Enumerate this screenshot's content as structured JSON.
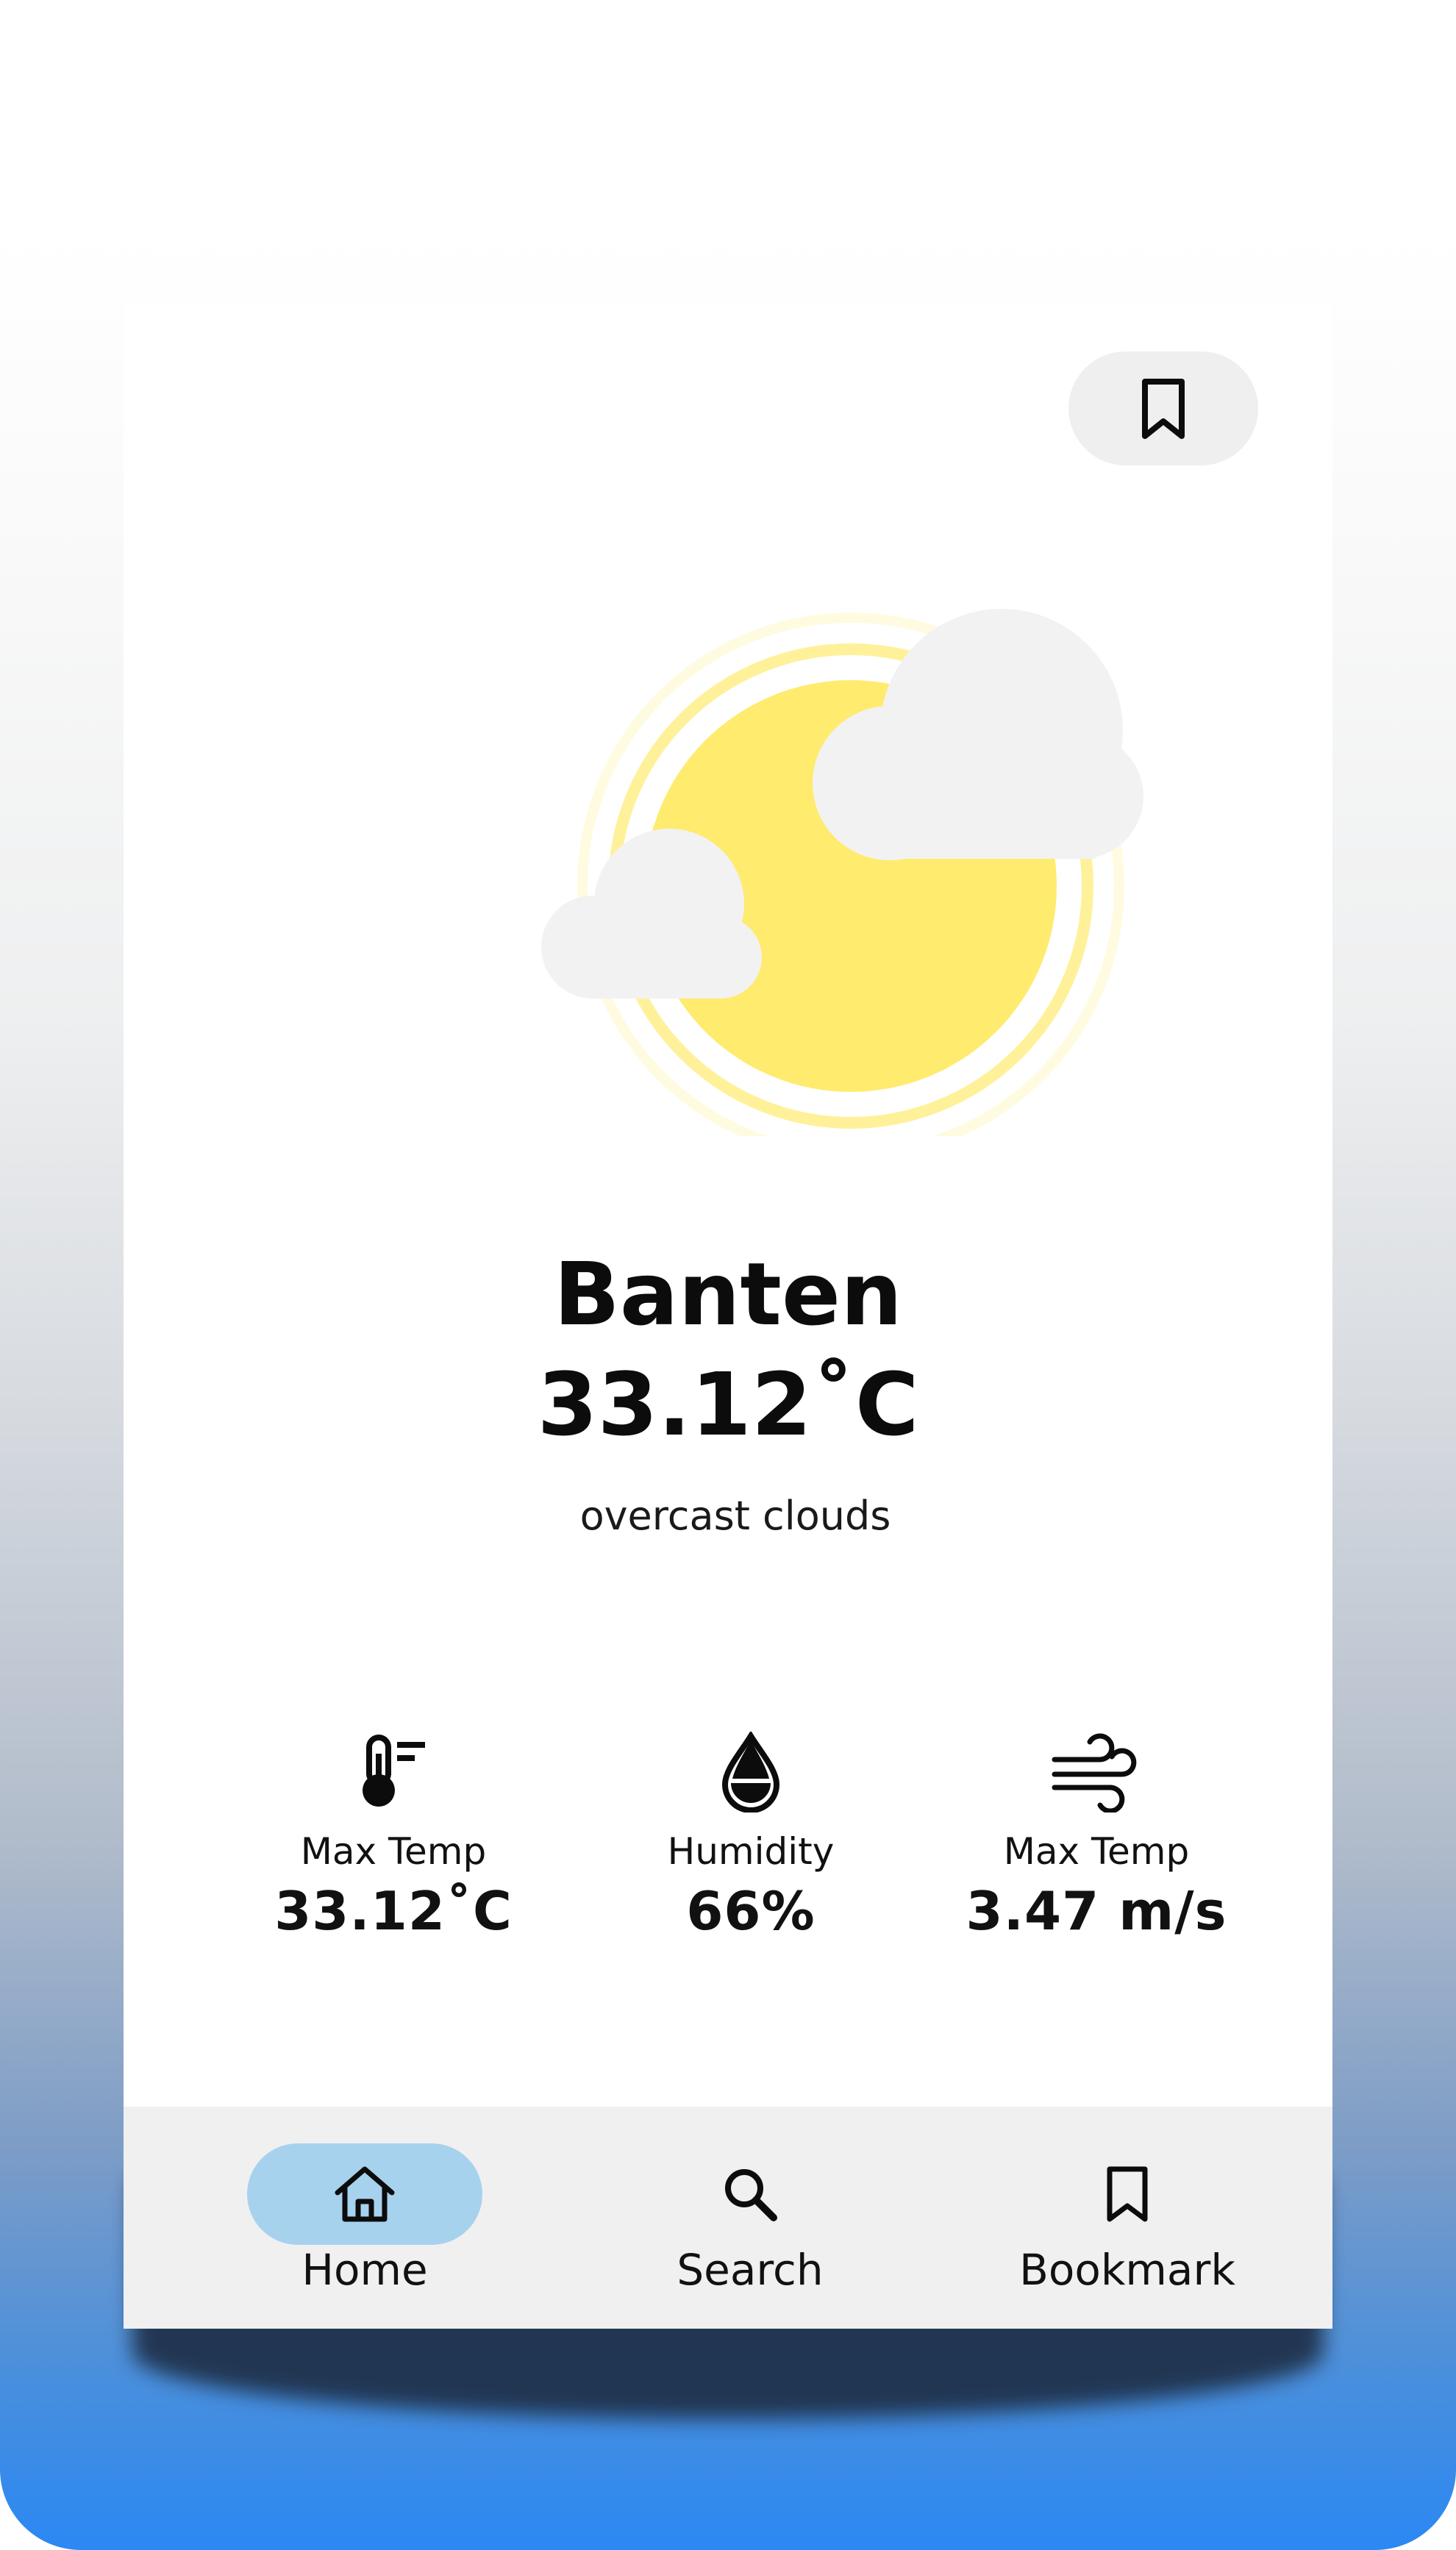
{
  "location": "Banten",
  "temperature": "33.12˚C",
  "description": "overcast clouds",
  "stats": [
    {
      "label": "Max Temp",
      "value": "33.12˚C",
      "icon": "thermometer-icon"
    },
    {
      "label": "Humidity",
      "value": "66%",
      "icon": "water-drop-icon"
    },
    {
      "label": "Max Temp",
      "value": "3.47 m/s",
      "icon": "wind-icon"
    }
  ],
  "nav": [
    {
      "label": "Home",
      "icon": "home-icon",
      "active": true
    },
    {
      "label": "Search",
      "icon": "search-icon",
      "active": false
    },
    {
      "label": "Bookmark",
      "icon": "bookmark-icon",
      "active": false
    }
  ],
  "colors": {
    "sun": "#ffeb6e",
    "cloud": "#f2f2f2",
    "nav_active": "#a7d2ee",
    "nav_bg": "#f0f0f0",
    "gradient_bottom": "#2b88f3"
  }
}
